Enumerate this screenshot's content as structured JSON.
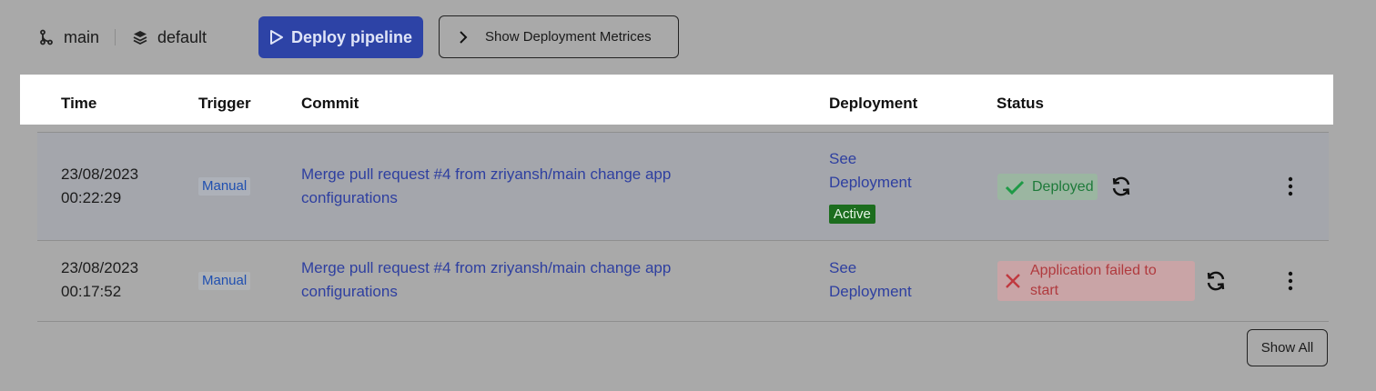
{
  "toolbar": {
    "branch": "main",
    "environment": "default",
    "deploy_label": "Deploy pipeline",
    "metrics_label": "Show Deployment Metrices"
  },
  "table": {
    "headers": {
      "time": "Time",
      "trigger": "Trigger",
      "commit": "Commit",
      "deployment": "Deployment",
      "status": "Status"
    },
    "rows": [
      {
        "date": "23/08/2023",
        "time": "00:22:29",
        "trigger": "Manual",
        "commit": "Merge pull request #4 from zriyansh/main change app configurations",
        "see_line1": "See",
        "see_line2": "Deployment",
        "badge": "Active",
        "status": "Deployed",
        "status_color": "#1e7a3a"
      },
      {
        "date": "23/08/2023",
        "time": "00:17:52",
        "trigger": "Manual",
        "commit": "Merge pull request #4 from zriyansh/main change app configurations",
        "see_line1": "See",
        "see_line2": "Deployment",
        "status": "Application failed to start",
        "status_color": "#b03a3e"
      }
    ]
  },
  "footer": {
    "show_all_label": "Show All"
  },
  "colors": {
    "accent": "#2d43a6",
    "link": "#2e3fa0",
    "success": "#1e7a3a",
    "danger": "#b03a3e"
  }
}
